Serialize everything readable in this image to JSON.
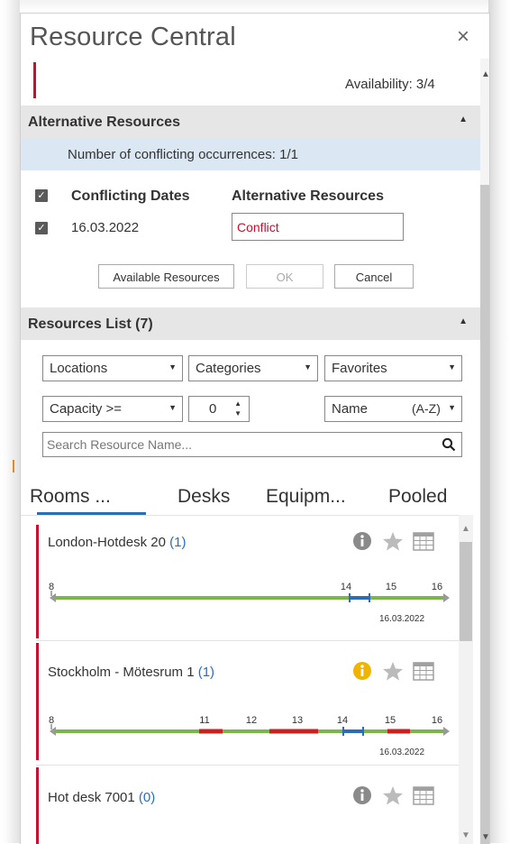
{
  "window": {
    "title": "Resource Central",
    "close_glyph": "×"
  },
  "availability": "Availability: 3/4",
  "alternative": {
    "header": "Alternative Resources",
    "notice": "Number of conflicting occurrences: 1/1",
    "col_dates": "Conflicting Dates",
    "col_alt": "Alternative Resources",
    "row_date": "16.03.2022",
    "row_value": "Conflict",
    "btn_available": "Available Resources",
    "btn_ok": "OK",
    "btn_cancel": "Cancel"
  },
  "list": {
    "header": "Resources List (7)",
    "filter_locations": "Locations",
    "filter_categories": "Categories",
    "filter_favorites": "Favorites",
    "filter_capacity": "Capacity >=",
    "capacity_value": "0",
    "sort_name": "Name",
    "sort_order": "(A-Z)",
    "search_placeholder": "Search Resource Name..."
  },
  "tabs": [
    "Rooms ...",
    "Desks",
    "Equipm...",
    "Pooled"
  ],
  "resources": [
    {
      "name": "London-Hotdesk 20",
      "count": "(1)",
      "info_color": "#8a8a8a",
      "ticks": [
        "8",
        "14",
        "15",
        "16"
      ],
      "date": "16.03.2022"
    },
    {
      "name": "Stockholm - Mötesrum 1",
      "count": "(1)",
      "info_color": "#f0b400",
      "ticks": [
        "8",
        "11",
        "12",
        "13",
        "14",
        "15",
        "16"
      ],
      "date": "16.03.2022"
    },
    {
      "name": "Hot desk 7001",
      "count": "(0)",
      "info_color": "#8a8a8a"
    }
  ],
  "colors": {
    "accent_red": "#c8102e",
    "available_green": "#7ab648",
    "booked_red": "#cc1f1f",
    "selection_blue": "#2a6ebb",
    "tab_underline": "#2a6ebb"
  },
  "icons": [
    "close-icon",
    "info-icon",
    "star-icon",
    "calendar-icon",
    "search-icon",
    "chevron-down-icon",
    "spinner-icon"
  ]
}
